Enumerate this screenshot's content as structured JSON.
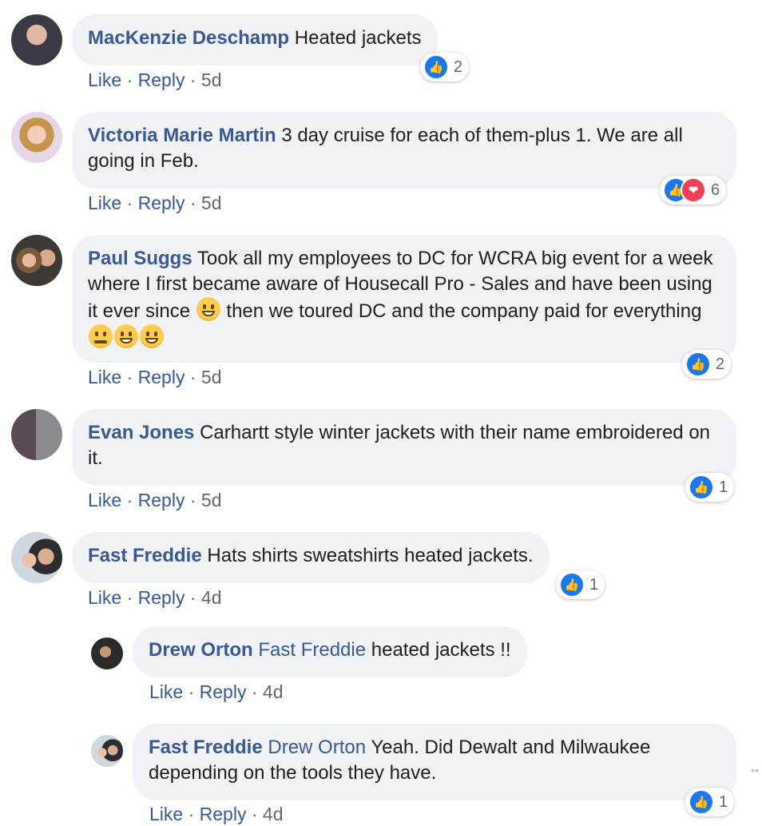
{
  "comments": [
    {
      "name": "MacKenzie Deschamp",
      "text": "Heated jackets",
      "like": "Like",
      "reply": "Reply",
      "time": "5d",
      "reactions": "2"
    },
    {
      "name": "Victoria Marie Martin",
      "text": "3 day cruise for each of them-plus 1. We are all going in Feb.",
      "like": "Like",
      "reply": "Reply",
      "time": "5d",
      "reactions": "6"
    },
    {
      "name": "Paul Suggs",
      "text1": "Took all my employees to DC for WCRA big event for a week where I first became aware of Housecall Pro - Sales and have been using it ever since",
      "text2": "then we toured DC and the company paid for everything",
      "like": "Like",
      "reply": "Reply",
      "time": "5d",
      "reactions": "2"
    },
    {
      "name": "Evan Jones",
      "text": "Carhartt style winter jackets with their name embroidered on it.",
      "like": "Like",
      "reply": "Reply",
      "time": "5d",
      "reactions": "1"
    },
    {
      "name": "Fast Freddie",
      "text": "Hats shirts sweatshirts heated jackets.",
      "like": "Like",
      "reply": "Reply",
      "time": "4d",
      "reactions": "1"
    }
  ],
  "replies": [
    {
      "name": "Drew Orton",
      "tag": "Fast Freddie",
      "text": "heated jackets !!",
      "like": "Like",
      "reply": "Reply",
      "time": "4d"
    },
    {
      "name": "Fast Freddie",
      "tag": "Drew Orton",
      "text": "Yeah. Did Dewalt and Milwaukee depending on the tools they have.",
      "like": "Like",
      "reply": "Reply",
      "time": "4d",
      "reactions": "1"
    }
  ],
  "separator": "·",
  "icons": {
    "like": "like-icon",
    "love": "love-icon",
    "emoji": "grin-emoji"
  },
  "colors": {
    "name": "#385898",
    "bubble": "#f0f2f5",
    "like": "#1877f2",
    "love": "#f33e58"
  }
}
